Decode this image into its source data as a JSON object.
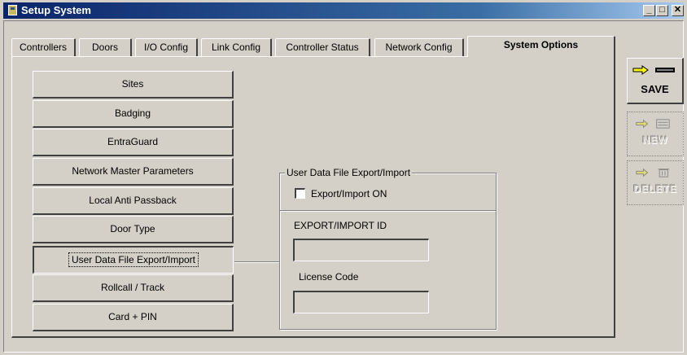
{
  "window": {
    "title": "Setup System"
  },
  "tabs": [
    {
      "label": "Controllers"
    },
    {
      "label": "Doors"
    },
    {
      "label": "I/O Config"
    },
    {
      "label": "Link Config"
    },
    {
      "label": "Controller Status"
    },
    {
      "label": "Network Config"
    },
    {
      "label": "System Options",
      "active": true
    }
  ],
  "options": [
    {
      "label": "Sites"
    },
    {
      "label": "Badging"
    },
    {
      "label": "EntraGuard"
    },
    {
      "label": "Network Master Parameters"
    },
    {
      "label": "Local Anti Passback"
    },
    {
      "label": "Door Type"
    },
    {
      "label": "User Data File Export/Import",
      "selected": true
    },
    {
      "label": "Rollcall / Track"
    },
    {
      "label": "Card + PIN"
    }
  ],
  "export_group": {
    "legend": "User Data File Export/Import",
    "checkbox_label": "Export/Import ON",
    "checkbox_checked": false,
    "id_label": "EXPORT/IMPORT ID",
    "id_value": "",
    "license_label": "License Code",
    "license_value": ""
  },
  "side_buttons": {
    "save": "SAVE",
    "new": "NEW",
    "delete": "DELETE"
  },
  "colors": {
    "face": "#d4d0c8",
    "title_start": "#0a246a",
    "arrow": "#ffff00"
  }
}
